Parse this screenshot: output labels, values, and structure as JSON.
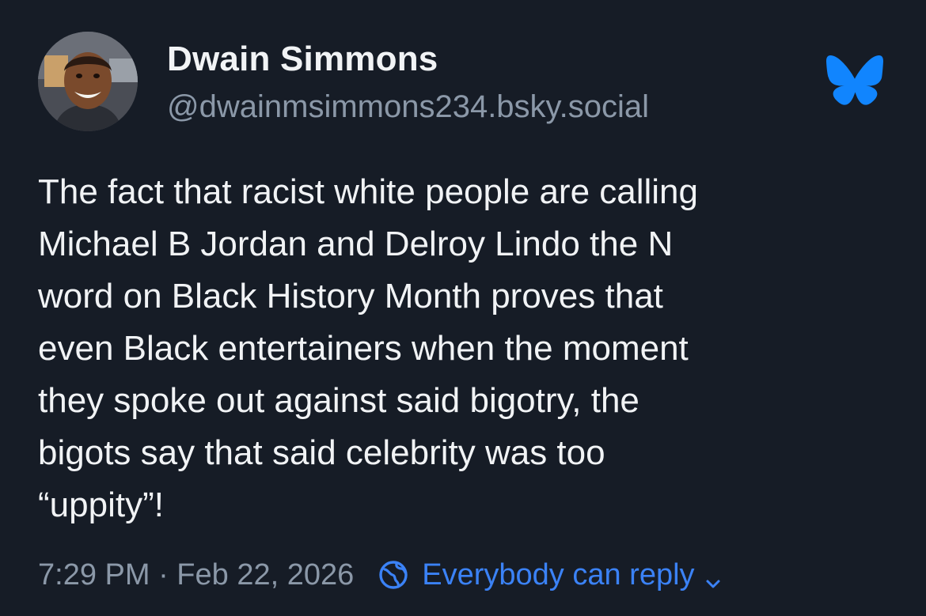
{
  "author": {
    "display_name": "Dwain Simmons",
    "handle": "@dwainmsimmons234.bsky.social",
    "avatar_icon": "user-avatar-photo"
  },
  "brand": {
    "logo_icon": "bluesky-butterfly-icon",
    "accent_color": "#1185fe"
  },
  "post": {
    "lines": [
      "The fact that racist white people are calling",
      "Michael B Jordan and Delroy Lindo the N",
      "word on Black History Month proves that",
      "even Black entertainers when the moment",
      "they spoke out against said bigotry, the",
      "bigots say that said celebrity was too",
      "“uppity”!"
    ]
  },
  "footer": {
    "timestamp": "7:29 PM · Feb 22, 2026",
    "reply_setting": "Everybody can reply",
    "reply_icon": "globe-icon",
    "dropdown_icon": "chevron-down-icon",
    "link_color": "#3b82f6"
  },
  "colors": {
    "background": "#161c26",
    "text_primary": "#f1f3f5",
    "text_secondary": "#8b98a8"
  }
}
